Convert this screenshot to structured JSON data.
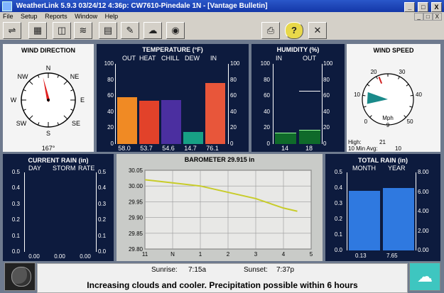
{
  "window": {
    "title": "WeatherLink 5.9.3  03/24/12   4:36p: CW7610-Pinedale 1N - [Vantage Bulletin]",
    "min": "_",
    "max": "□",
    "close": "X"
  },
  "menu": [
    "File",
    "Setup",
    "Reports",
    "Window",
    "Help"
  ],
  "mdi_buttons": [
    "_",
    "□",
    "X"
  ],
  "toolbar": {
    "icons": [
      "connect-icon",
      "station-icon",
      "bulletin-icon",
      "strip-chart-icon",
      "summary-icon",
      "notepad-icon",
      "weather-icon",
      "noaa-icon",
      "print-icon",
      "help-icon",
      "close-icon"
    ],
    "help_glyph": "?",
    "close_glyph": "✕"
  },
  "wind_direction": {
    "title": "WIND DIRECTION",
    "labels": {
      "n": "N",
      "ne": "NE",
      "e": "E",
      "se": "SE",
      "s": "S",
      "sw": "SW",
      "w": "W",
      "nw": "NW"
    },
    "value": "167°",
    "degrees": 167
  },
  "temperature": {
    "title": "TEMPERATURE  (°F)",
    "columns": [
      "OUT",
      "HEAT",
      "CHILL",
      "DEW",
      "IN"
    ],
    "scale": [
      "100",
      "80",
      "60",
      "40",
      "20",
      "0"
    ],
    "bars": [
      {
        "value": 58.0,
        "label": "58.0",
        "color": "#f08a24"
      },
      {
        "value": 53.7,
        "label": "53.7",
        "color": "#e2422a"
      },
      {
        "value": 54.6,
        "label": "54.6",
        "color": "#4b2fa0"
      },
      {
        "value": 14.7,
        "label": "14.7",
        "color": "#17a085"
      },
      {
        "value": 76.1,
        "label": "76.1",
        "color": "#e8563a"
      }
    ]
  },
  "humidity": {
    "title": "HUMIDITY  (%)",
    "columns": [
      "IN",
      "OUT"
    ],
    "scale": [
      "100",
      "80",
      "60",
      "40",
      "20",
      "0"
    ],
    "bars": [
      {
        "value": 14,
        "label": "14"
      },
      {
        "value": 18,
        "label": "18"
      }
    ],
    "high_marker": 66
  },
  "wind_speed": {
    "title": "WIND SPEED",
    "ticks": [
      "0",
      "10",
      "20",
      "30",
      "40",
      "50"
    ],
    "unit": "Mph",
    "value": "9",
    "speed": 9,
    "gust": 21,
    "high_label": "High:",
    "high": "21",
    "avg_label": "10 Min Avg:",
    "avg": "10"
  },
  "current_rain": {
    "title": "CURRENT RAIN  (in)",
    "columns": [
      "DAY",
      "STORM",
      "RATE"
    ],
    "scale": [
      "0.5",
      "0.4",
      "0.3",
      "0.2",
      "0.1",
      "0.0"
    ],
    "values": [
      "0.00",
      "0.00",
      "0.00"
    ]
  },
  "barometer": {
    "title": "BAROMETER 29.915  in",
    "yticks": [
      "30.05",
      "30.00",
      "29.95",
      "29.90",
      "29.85",
      "29.80"
    ],
    "xticks": [
      "11",
      "N",
      "1",
      "2",
      "3",
      "4",
      "5"
    ]
  },
  "total_rain": {
    "title": "TOTAL RAIN  (in)",
    "columns": [
      "MONTH",
      "YEAR"
    ],
    "left_scale": [
      "0.5",
      "0.4",
      "0.3",
      "0.2",
      "0.1",
      "0.0"
    ],
    "right_scale": [
      "8.00",
      "6.00",
      "4.00",
      "2.00",
      "0.00"
    ],
    "values": [
      "0.13",
      "7.65"
    ]
  },
  "sun": {
    "sunrise_label": "Sunrise:",
    "sunrise": "7:15a",
    "sunset_label": "Sunset:",
    "sunset": "7:37p"
  },
  "forecast": "Increasing clouds and cooler.  Precipitation possible within 6 hours",
  "chart_data": {
    "type": "line",
    "title": "BAROMETER 29.915  in",
    "xlabel": "",
    "ylabel": "",
    "x": [
      "11",
      "N",
      "1",
      "2",
      "3",
      "4",
      "4.5"
    ],
    "series": [
      {
        "values": [
          30.02,
          30.01,
          30.0,
          29.98,
          29.96,
          29.93,
          29.92
        ]
      }
    ],
    "ylim": [
      29.8,
      30.05
    ],
    "grid": true
  }
}
